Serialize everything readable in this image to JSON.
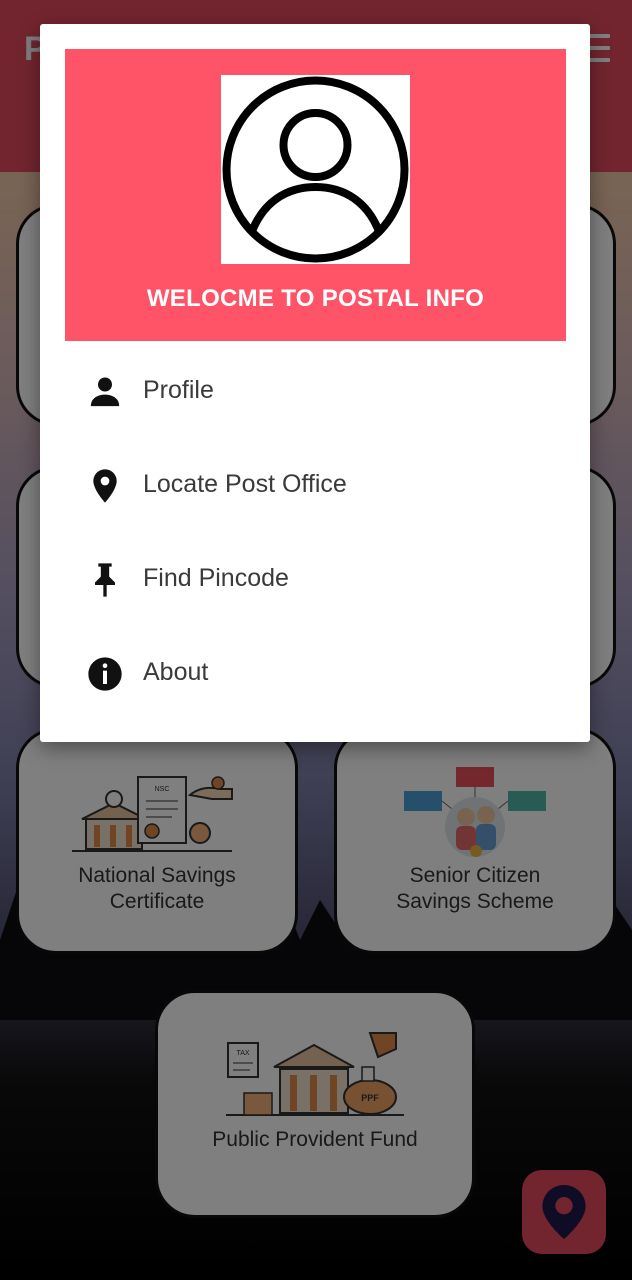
{
  "appbar": {
    "title_partial": "P"
  },
  "drawer": {
    "header_title": "WELOCME TO POSTAL INFO",
    "items": [
      {
        "label": "Profile",
        "icon": "person-icon"
      },
      {
        "label": "Locate Post Office",
        "icon": "location-pin-icon"
      },
      {
        "label": "Find Pincode",
        "icon": "pushpin-icon"
      },
      {
        "label": "About",
        "icon": "info-icon"
      }
    ]
  },
  "cards": {
    "nsc": {
      "label_line1": "National Savings",
      "label_line2": "Certificate",
      "illustration_text": "NSC"
    },
    "scss": {
      "label_line1": "Senior Citizen",
      "label_line2": "Savings Scheme"
    },
    "ppf": {
      "label": "Public Provident Fund",
      "illustration_text_1": "TAX",
      "illustration_text_2": "PPF"
    }
  },
  "colors": {
    "accent": "#ff5468",
    "appbar": "#e64a5e",
    "fab_icon": "#1f1a4d"
  }
}
